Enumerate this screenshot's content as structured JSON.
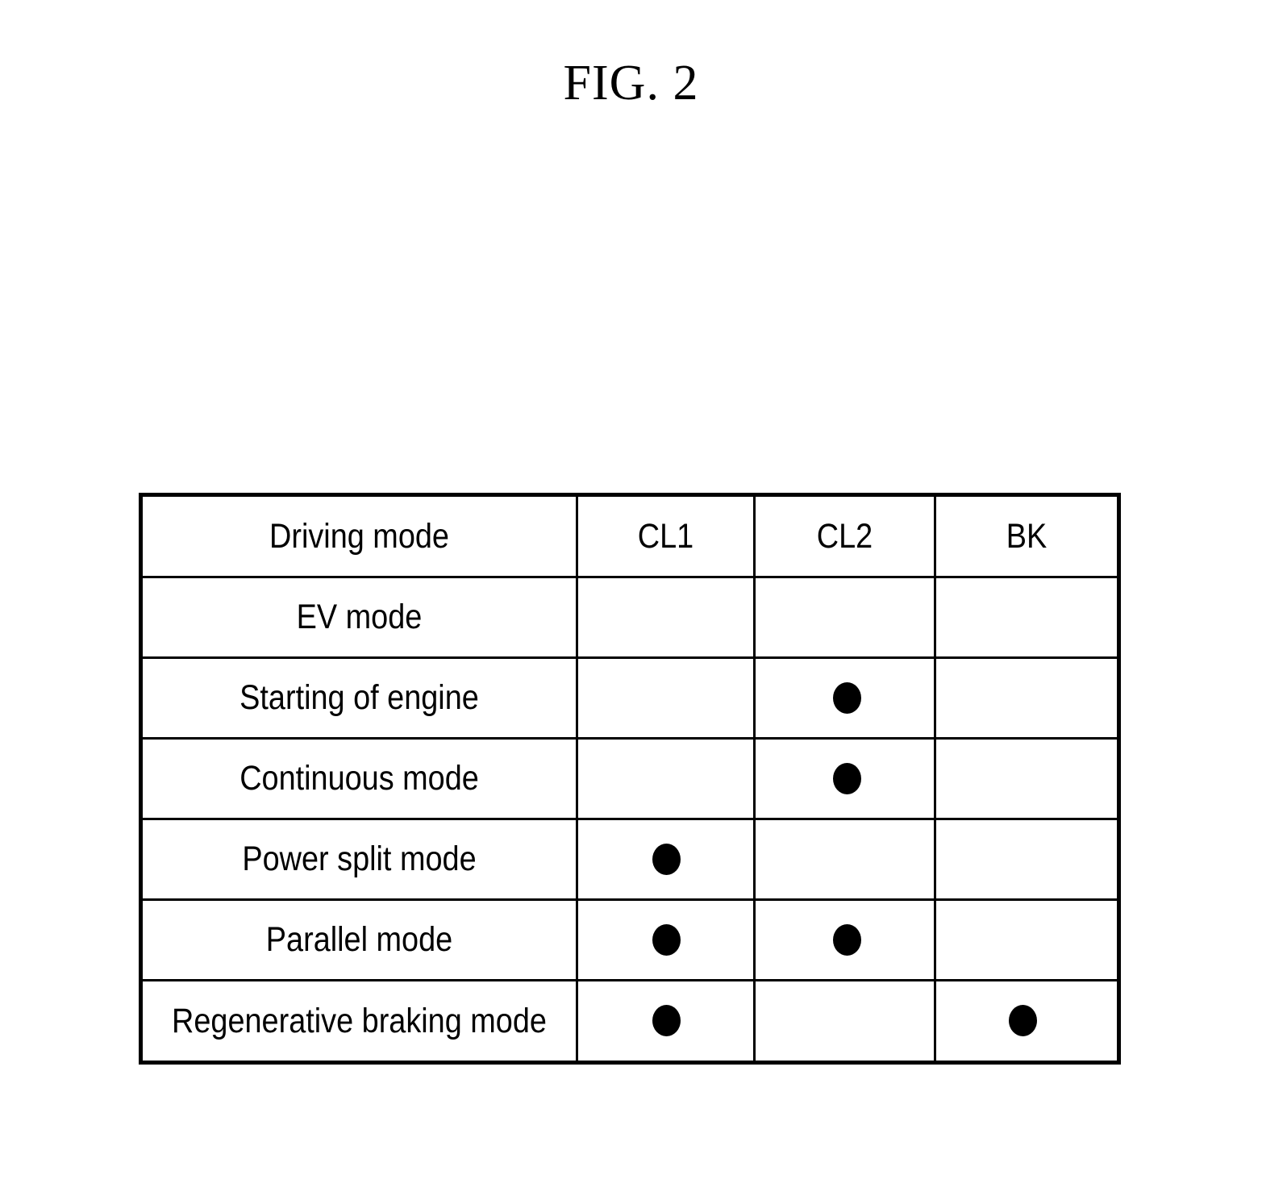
{
  "figure": {
    "title": "FIG. 2"
  },
  "table": {
    "columns": [
      {
        "key": "mode",
        "label": "Driving mode"
      },
      {
        "key": "cl1",
        "label": "CL1"
      },
      {
        "key": "cl2",
        "label": "CL2"
      },
      {
        "key": "bk",
        "label": "BK"
      }
    ],
    "marker": "●",
    "rows": [
      {
        "label": "EV mode",
        "cl1": "",
        "cl2": "",
        "bk": ""
      },
      {
        "label": "Starting of engine",
        "cl1": "",
        "cl2": "●",
        "bk": ""
      },
      {
        "label": "Continuous mode",
        "cl1": "",
        "cl2": "●",
        "bk": ""
      },
      {
        "label": "Power split mode",
        "cl1": "●",
        "cl2": "",
        "bk": ""
      },
      {
        "label": "Parallel mode",
        "cl1": "●",
        "cl2": "●",
        "bk": ""
      },
      {
        "label": "Regenerative braking mode",
        "cl1": "●",
        "cl2": "",
        "bk": "●"
      }
    ]
  },
  "colors": {
    "ink": "#000000",
    "paper": "#ffffff"
  }
}
